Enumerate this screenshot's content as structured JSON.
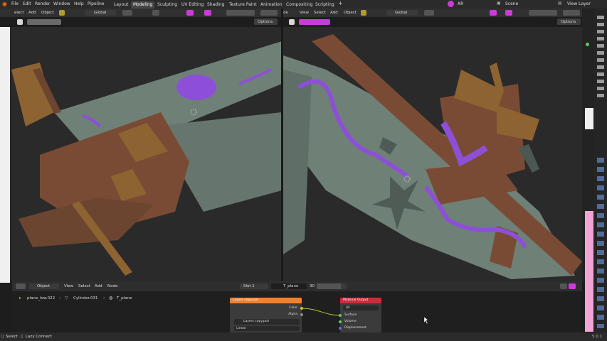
{
  "menubar": {
    "items": [
      "File",
      "Edit",
      "Render",
      "Window",
      "Help",
      "Pipeline"
    ],
    "workspaces": [
      "Layout",
      "Modeling",
      "Sculpting",
      "UV Editing",
      "Shading",
      "Texture Paint",
      "Animation",
      "Compositing",
      "Scripting"
    ],
    "active_workspace": "Modeling",
    "user": "AR",
    "scene": "Scene",
    "view_layer": "View Layer"
  },
  "viewport_left": {
    "menu": [
      "elect",
      "Add",
      "Object"
    ],
    "transform": "Global",
    "options": "Options"
  },
  "viewport_right": {
    "menu": [
      "de",
      "View",
      "Select",
      "Add",
      "Object"
    ],
    "transform": "Global",
    "options": "Options"
  },
  "node_editor": {
    "header": {
      "editor_type": "Object",
      "menu": [
        "View",
        "Select",
        "Add",
        "Node"
      ],
      "slot": "Slot 1",
      "material": "T_plane",
      "users": "30"
    },
    "breadcrumb": [
      "plane_low.022",
      "Cylinder.031",
      "T_plane"
    ],
    "image_node": {
      "title": "Layers copy.psd",
      "outputs": [
        "Color",
        "Alpha"
      ],
      "image": "Layers copy.psd",
      "interpolation": "Linear"
    },
    "output_node": {
      "title": "Material Output",
      "target": "All",
      "inputs": [
        "Surface",
        "Volume",
        "Displacement"
      ]
    }
  },
  "statusbar": {
    "left": [
      "Select",
      "Lazy Connect"
    ],
    "version": "5.0.1"
  },
  "colors": {
    "accent_active": "#ca3bd9",
    "image_node_header": "#e8843a",
    "output_node_header": "#c4303a",
    "socket_yellow": "#c7c729",
    "socket_green": "#63c763",
    "plane_gray": "#6f8077",
    "plane_brown": "#7a4b34",
    "plane_ochre": "#8e6332",
    "plane_purple": "#8e4fd8"
  }
}
